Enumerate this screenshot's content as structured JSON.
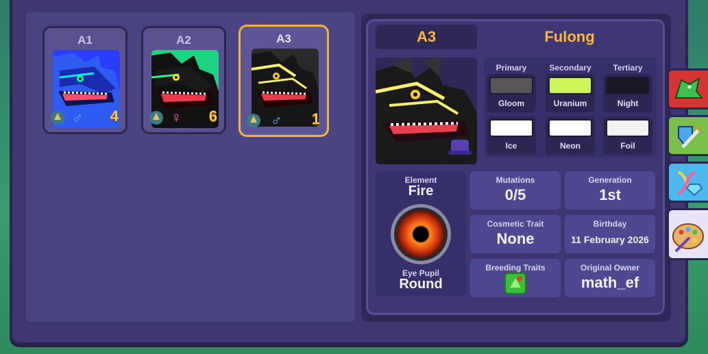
{
  "colors": {
    "accent_orange": "#ffb43a",
    "selected_border": "#f3b342",
    "number_yellow": "#ffc93a",
    "male_blue": "#58b2ff",
    "female_pink": "#ff6fc8"
  },
  "cards": [
    {
      "label": "A1",
      "gender_symbol": "♂",
      "gender": "male",
      "count": "4",
      "palette": "blue"
    },
    {
      "label": "A2",
      "gender_symbol": "♀",
      "gender": "female",
      "count": "6",
      "palette": "green"
    },
    {
      "label": "A3",
      "gender_symbol": "♂",
      "gender": "male",
      "count": "1",
      "palette": "black-yellow",
      "selected": true
    }
  ],
  "detail": {
    "name": "A3",
    "species": "Fulong",
    "colors": {
      "headers": [
        "Primary",
        "Secondary",
        "Tertiary"
      ],
      "row1": [
        {
          "name": "Gloom",
          "hex": "#5a5556"
        },
        {
          "name": "Uranium",
          "hex": "#cdf55a"
        },
        {
          "name": "Night",
          "hex": "#1a1626"
        }
      ],
      "row2": [
        {
          "name": "Ice",
          "hex": "#ffffff"
        },
        {
          "name": "Neon",
          "hex": "#ffffff"
        },
        {
          "name": "Foil",
          "hex": "#f2f2f2"
        }
      ]
    },
    "element": {
      "label": "Element",
      "value": "Fire"
    },
    "eye_pupil": {
      "label": "Eye Pupil",
      "value": "Round"
    },
    "mutations": {
      "label": "Mutations",
      "value": "0/5"
    },
    "generation": {
      "label": "Generation",
      "value": "1st"
    },
    "cosmetic_trait": {
      "label": "Cosmetic Trait",
      "value": "None"
    },
    "birthday": {
      "label": "Birthday",
      "value": "11 February 2026"
    },
    "breeding_traits": {
      "label": "Breeding Traits",
      "icon": "breeding-trait-icon"
    },
    "original_owner": {
      "label": "Original Owner",
      "value": "math_ef"
    }
  },
  "side_tabs": [
    {
      "icon": "dragon-icon",
      "color": "#d43636"
    },
    {
      "icon": "sword-shield-icon",
      "color": "#7ac04a"
    },
    {
      "icon": "dna-gem-icon",
      "color": "#4db8ee"
    },
    {
      "icon": "palette-icon",
      "color": "#e8e4f5"
    }
  ]
}
